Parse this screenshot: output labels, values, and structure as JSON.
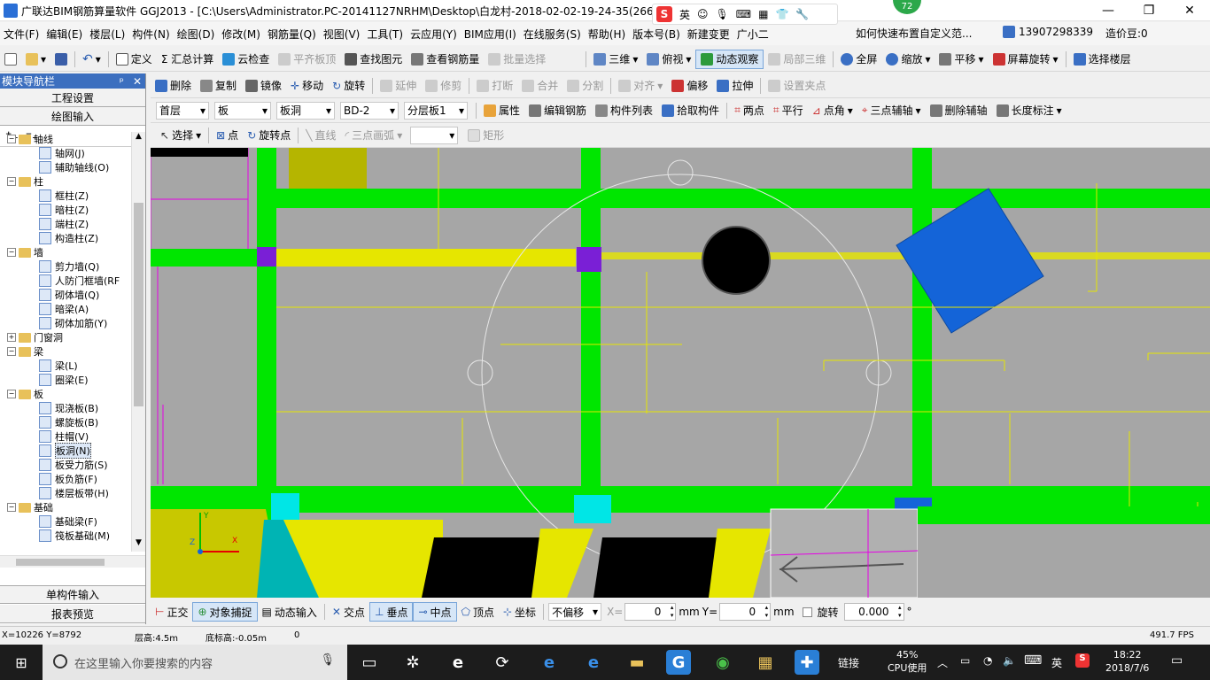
{
  "window": {
    "title": "广联达BIM钢筋算量软件 GGJ2013 - [C:\\Users\\Administrator.PC-20141127NRHM\\Desktop\\白龙村-2018-02-02-19-24-35(2666版).GGJ12]",
    "minimize": "—",
    "maximize": "❐",
    "close": "✕"
  },
  "ime": {
    "logo": "S",
    "lang": "英"
  },
  "badge": "72",
  "menu": {
    "items": [
      "文件(F)",
      "编辑(E)",
      "楼层(L)",
      "构件(N)",
      "绘图(D)",
      "修改(M)",
      "钢筋量(Q)",
      "视图(V)",
      "工具(T)",
      "云应用(Y)",
      "BIM应用(I)",
      "在线服务(S)",
      "帮助(H)",
      "版本号(B)",
      "新建变更",
      "广小二"
    ],
    "help_link": "如何快速布置自定义范...",
    "phone": "13907298339",
    "beans": "造价豆:0"
  },
  "toolbar1": {
    "define": "定义",
    "sum": "Σ 汇总计算",
    "cloud_check": "云检查",
    "align_slab": "平齐板顶",
    "find": "查找图元",
    "view_rebar": "查看钢筋量",
    "batch": "批量选择",
    "three_d": "三维",
    "top_view": "俯视",
    "dynamic": "动态观察",
    "local3d": "局部三维",
    "fullscreen": "全屏",
    "zoom": "缩放",
    "pan": "平移",
    "rotate_screen": "屏幕旋转",
    "select_floor": "选择楼层"
  },
  "toolbar2": {
    "delete": "删除",
    "copy": "复制",
    "mirror": "镜像",
    "move": "移动",
    "rotate": "旋转",
    "extend": "延伸",
    "trim": "修剪",
    "break": "打断",
    "merge": "合并",
    "split": "分割",
    "align": "对齐",
    "offset": "偏移",
    "stretch": "拉伸",
    "set_grip": "设置夹点"
  },
  "toolbar3": {
    "floor": "首层",
    "type": "板",
    "subtype": "板洞",
    "name": "BD-2",
    "layer": "分层板1",
    "properties": "属性",
    "edit_rebar": "编辑钢筋",
    "comp_list": "构件列表",
    "pick": "拾取构件",
    "two_point": "两点",
    "parallel": "平行",
    "point_angle": "点角",
    "three_point_aux": "三点辅轴",
    "delete_aux": "删除辅轴",
    "length_dim": "长度标注"
  },
  "toolbar4": {
    "select": "选择",
    "point": "点",
    "rotate_point": "旋转点",
    "line": "直线",
    "arc3": "三点画弧",
    "rect": "矩形"
  },
  "nav": {
    "header": "模块导航栏",
    "pin": "ᵖ",
    "close": "✕",
    "eng_settings": "工程设置",
    "draw_input": "绘图输入",
    "single_input": "单构件输入",
    "report": "报表预览",
    "tree": [
      {
        "level": 0,
        "toggle": "−",
        "label": "轴线"
      },
      {
        "level": 1,
        "label": "轴网(J)"
      },
      {
        "level": 1,
        "label": "辅助轴线(O)"
      },
      {
        "level": 0,
        "toggle": "−",
        "label": "柱"
      },
      {
        "level": 1,
        "label": "框柱(Z)"
      },
      {
        "level": 1,
        "label": "暗柱(Z)"
      },
      {
        "level": 1,
        "label": "端柱(Z)"
      },
      {
        "level": 1,
        "label": "构造柱(Z)"
      },
      {
        "level": 0,
        "toggle": "−",
        "label": "墙"
      },
      {
        "level": 1,
        "label": "剪力墙(Q)"
      },
      {
        "level": 1,
        "label": "人防门框墙(RF"
      },
      {
        "level": 1,
        "label": "砌体墙(Q)"
      },
      {
        "level": 1,
        "label": "暗梁(A)"
      },
      {
        "level": 1,
        "label": "砌体加筋(Y)"
      },
      {
        "level": 0,
        "toggle": "+",
        "label": "门窗洞"
      },
      {
        "level": 0,
        "toggle": "−",
        "label": "梁"
      },
      {
        "level": 1,
        "label": "梁(L)"
      },
      {
        "level": 1,
        "label": "圈梁(E)"
      },
      {
        "level": 0,
        "toggle": "−",
        "label": "板"
      },
      {
        "level": 1,
        "label": "现浇板(B)"
      },
      {
        "level": 1,
        "label": "螺旋板(B)"
      },
      {
        "level": 1,
        "label": "柱帽(V)"
      },
      {
        "level": 1,
        "label": "板洞(N)",
        "selected": true
      },
      {
        "level": 1,
        "label": "板受力筋(S)"
      },
      {
        "level": 1,
        "label": "板负筋(F)"
      },
      {
        "level": 1,
        "label": "楼层板带(H)"
      },
      {
        "level": 0,
        "toggle": "−",
        "label": "基础"
      },
      {
        "level": 1,
        "label": "基础梁(F)"
      },
      {
        "level": 1,
        "label": "筏板基础(M)"
      }
    ]
  },
  "status": {
    "ortho": "正交",
    "snap": "对象捕捉",
    "dyn_input": "动态输入",
    "intersect": "交点",
    "perp": "垂点",
    "mid": "中点",
    "vertex": "顶点",
    "coord": "坐标",
    "offset_mode": "不偏移",
    "x_label": "X=",
    "x_val": "0",
    "mm1": "mm",
    "y_label": "Y=",
    "y_val": "0",
    "mm2": "mm",
    "rotate": "旋转",
    "rotate_val": "0.000",
    "deg": "°"
  },
  "info": {
    "coords": "X=10226 Y=8792",
    "floor_height": "层高:4.5m",
    "bottom_height": "底标高:-0.05m",
    "zero": "0",
    "fps": "491.7 FPS"
  },
  "taskbar": {
    "search_placeholder": "在这里输入你要搜索的内容",
    "link": "链接",
    "cpu_pct": "45%",
    "cpu_label": "CPU使用",
    "lang": "英",
    "time": "18:22",
    "date": "2018/7/6"
  },
  "colors": {
    "green": "#00e600",
    "yellow": "#e6e600",
    "blue": "#1464d8",
    "purple": "#7a1fd6",
    "cyan": "#00e6e6",
    "magenta": "#e600e6",
    "gray": "#a6a6a6"
  }
}
